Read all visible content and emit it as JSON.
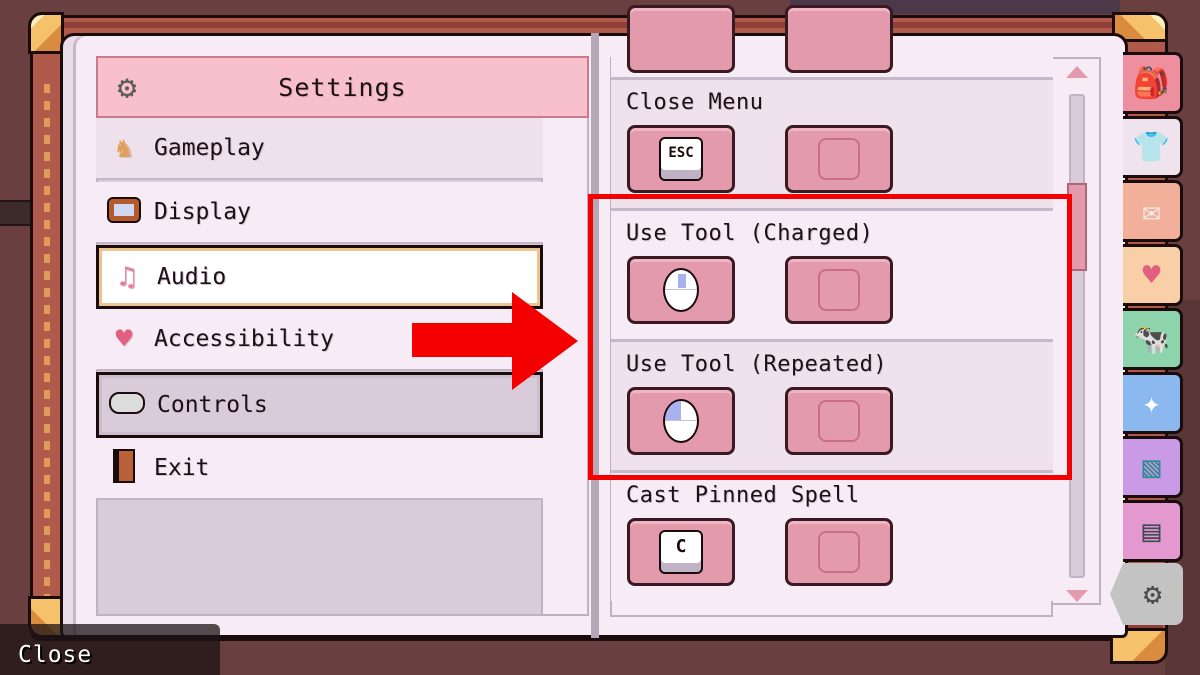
{
  "left_page": {
    "header": {
      "title": "Settings",
      "icon": "gear-icon"
    },
    "menu": [
      {
        "label": "Gameplay",
        "icon": "chess-knight-icon",
        "state": "normal"
      },
      {
        "label": "Display",
        "icon": "tv-icon",
        "state": "normal"
      },
      {
        "label": "Audio",
        "icon": "music-notes-icon",
        "state": "hovered"
      },
      {
        "label": "Accessibility",
        "icon": "heart-icon",
        "state": "normal"
      },
      {
        "label": "Controls",
        "icon": "gamepad-icon",
        "state": "selected"
      },
      {
        "label": "Exit",
        "icon": "door-icon",
        "state": "normal"
      }
    ]
  },
  "right_page": {
    "bindings": [
      {
        "action": "Close Menu",
        "primary": {
          "type": "key",
          "key": "ESC"
        },
        "secondary": {
          "type": "empty"
        }
      },
      {
        "action": "Use Tool (Charged)",
        "primary": {
          "type": "mouse",
          "button": "middle"
        },
        "secondary": {
          "type": "empty"
        }
      },
      {
        "action": "Use Tool (Repeated)",
        "primary": {
          "type": "mouse",
          "button": "left"
        },
        "secondary": {
          "type": "empty"
        }
      },
      {
        "action": "Cast Pinned Spell",
        "primary": {
          "type": "key",
          "key": "C"
        },
        "secondary": {
          "type": "empty"
        }
      }
    ],
    "scrollbar": {
      "position_fraction": 0.2
    }
  },
  "side_tabs": [
    {
      "name": "inventory",
      "icon": "backpack-icon",
      "color": "#ee8fa0"
    },
    {
      "name": "wardrobe",
      "icon": "shirt-icon",
      "color": "#efe3ee"
    },
    {
      "name": "mail",
      "icon": "envelope-icon",
      "color": "#f2b09a"
    },
    {
      "name": "relationships",
      "icon": "heart-icon",
      "color": "#f8cfa6"
    },
    {
      "name": "animals",
      "icon": "cow-icon",
      "color": "#8dd4ac"
    },
    {
      "name": "magic",
      "icon": "sparkles-icon",
      "color": "#8bb8ef"
    },
    {
      "name": "map",
      "icon": "map-icon",
      "color": "#c99ae6"
    },
    {
      "name": "journal",
      "icon": "book-icon",
      "color": "#e398cf"
    },
    {
      "name": "settings",
      "icon": "gear-icon",
      "color": "#c3c3c3",
      "active": true
    }
  ],
  "footer": {
    "close_label": "Close"
  },
  "annotation": {
    "highlight_color": "#f50000"
  }
}
